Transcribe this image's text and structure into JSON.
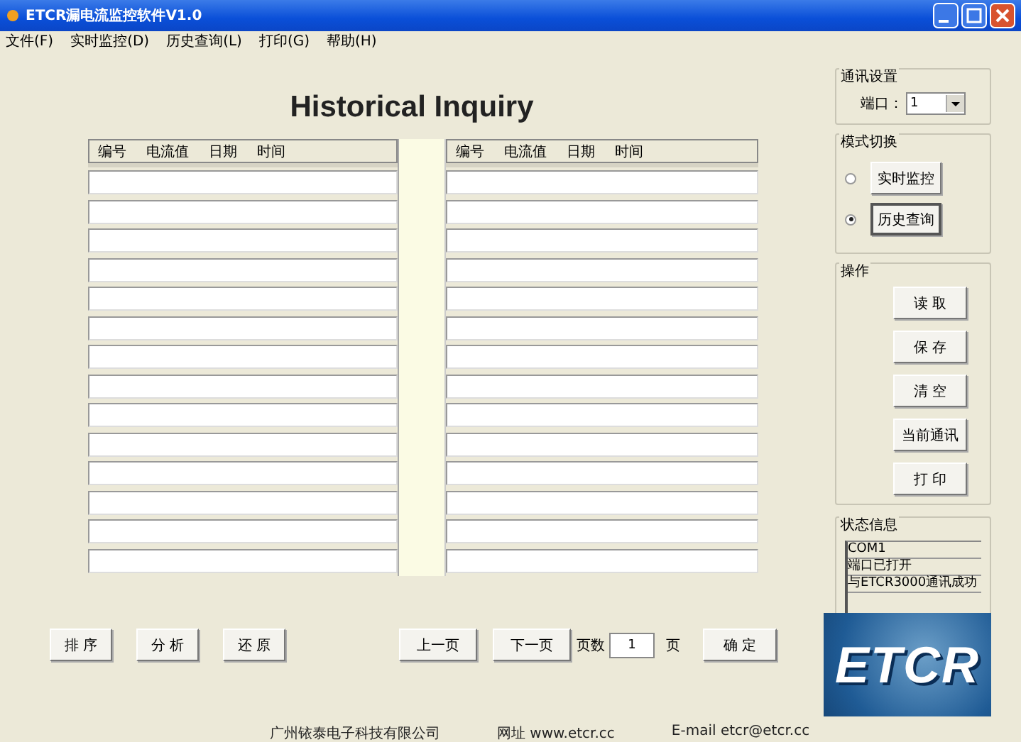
{
  "window": {
    "title": "ETCR漏电流监控软件V1.0"
  },
  "menu": [
    "文件(F)",
    "实时监控(D)",
    "历史查询(L)",
    "打印(G)",
    "帮助(H)"
  ],
  "heading": "Historical Inquiry",
  "table": {
    "left_columns": [
      "编号",
      "电流值",
      "日期",
      "时间"
    ],
    "right_columns": [
      "编号",
      "电流值",
      "日期",
      "时间"
    ]
  },
  "comm": {
    "title": "通讯设置",
    "port_label": "端口：",
    "port_value": "1"
  },
  "mode": {
    "title": "模式切换",
    "options": [
      {
        "label": "实时监控",
        "selected": false
      },
      {
        "label": "历史查询",
        "selected": true
      }
    ]
  },
  "operations": {
    "title": "操作",
    "buttons": [
      "读 取",
      "保 存",
      "清 空",
      "当前通讯",
      "打 印"
    ]
  },
  "status": {
    "title": "状态信息",
    "lines": [
      "COM1",
      "端口已打开",
      "与ETCR3000通讯成功"
    ]
  },
  "bottom": {
    "left_buttons": [
      "排 序",
      "分 析",
      "还 原"
    ],
    "prev": "上一页",
    "next": "下一页",
    "page_label": "页数",
    "page_value": "1",
    "page_unit": "页",
    "confirm": "确 定"
  },
  "logo": "ETCR",
  "footer": [
    "广州铱泰电子科技有限公司",
    "网址 www.etcr.cc",
    "E-mail etcr@etcr.cc"
  ]
}
